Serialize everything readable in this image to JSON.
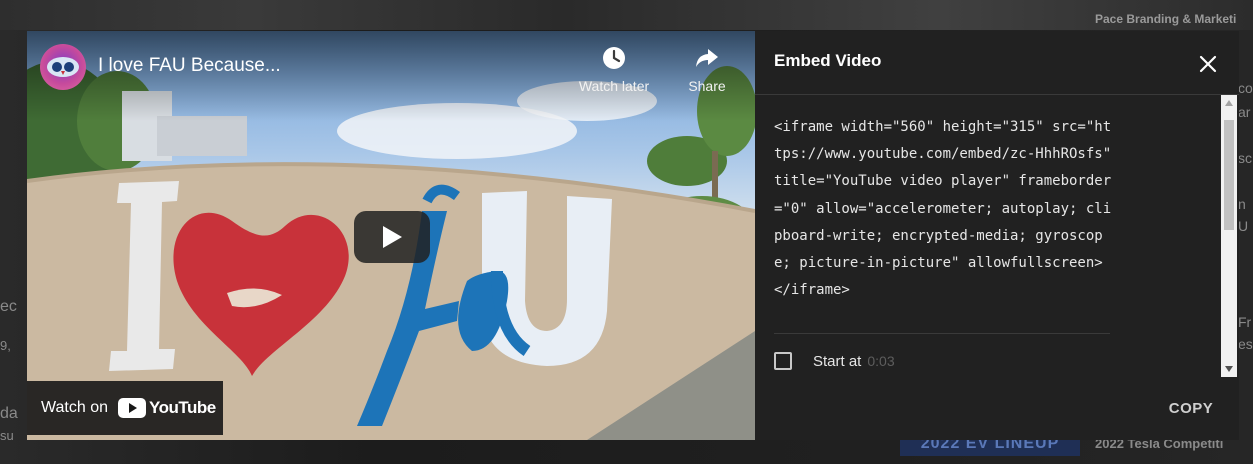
{
  "background_page": {
    "right_title": "Pace Branding & Marketi",
    "lineup_banner": "2022 EV LINEUP",
    "bottom_right": "2022 Tesla Competiti",
    "left_edge": [
      "ec",
      "9,",
      "da",
      "su"
    ],
    "right_edge": [
      "co",
      "ar",
      "sc",
      "n",
      "U",
      "Fr",
      "es"
    ]
  },
  "player": {
    "title": "I love FAU Because...",
    "watch_later_label": "Watch later",
    "share_label": "Share",
    "watch_on_label": "Watch on",
    "youtube_word": "YouTube",
    "scene_text": "I fau U"
  },
  "embed": {
    "title": "Embed Video",
    "code": "<iframe width=\"560\" height=\"315\" src=\"https://www.youtube.com/embed/zc-HhhROsfs\" title=\"YouTube video player\" frameborder=\"0\" allow=\"accelerometer; autoplay; clipboard-write; encrypted-media; gyroscope; picture-in-picture\" allowfullscreen></iframe>",
    "start_at_label": "Start at",
    "start_at_time": "0:03",
    "start_at_checked": false,
    "copy_label": "COPY"
  },
  "colors": {
    "panel_bg": "#212121",
    "youtube_red": "#ff0000",
    "heart_red": "#c8323a",
    "fau_blue": "#1d74b8"
  }
}
